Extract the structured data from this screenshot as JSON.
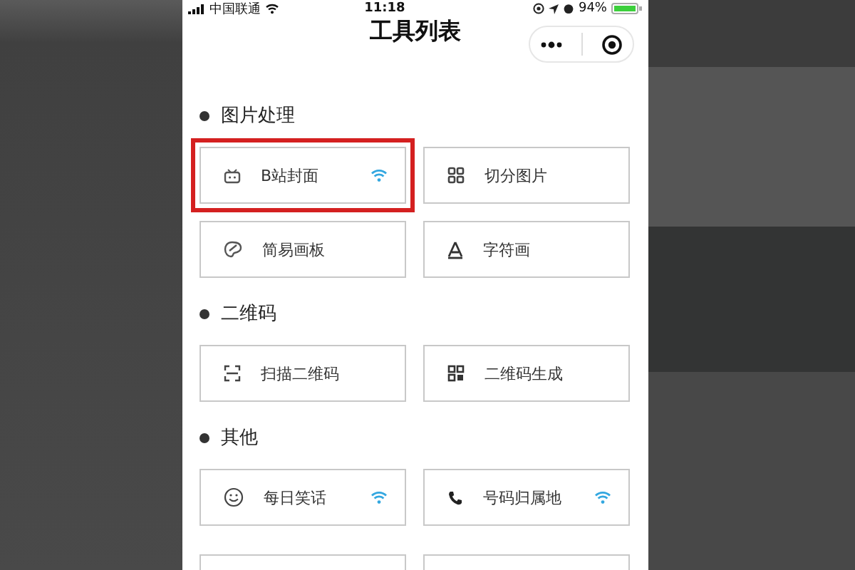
{
  "status_bar": {
    "carrier": "中国联通",
    "time": "11:18",
    "battery": "94%"
  },
  "nav": {
    "title": "工具列表"
  },
  "sections": [
    {
      "title": "图片处理",
      "items": [
        {
          "label": "B站封面",
          "kind": "tv",
          "wifi": true,
          "highlighted": true
        },
        {
          "label": "切分图片",
          "kind": "grid",
          "wifi": false,
          "highlighted": false
        },
        {
          "label": "简易画板",
          "kind": "palette",
          "wifi": false,
          "highlighted": false
        },
        {
          "label": "字符画",
          "kind": "letter",
          "wifi": false,
          "highlighted": false
        }
      ]
    },
    {
      "title": "二维码",
      "items": [
        {
          "label": "扫描二维码",
          "kind": "scan",
          "wifi": false,
          "highlighted": false
        },
        {
          "label": "二维码生成",
          "kind": "qr",
          "wifi": false,
          "highlighted": false
        }
      ]
    },
    {
      "title": "其他",
      "items": [
        {
          "label": "每日笑话",
          "kind": "smile",
          "wifi": true,
          "highlighted": false
        },
        {
          "label": "号码归属地",
          "kind": "phone",
          "wifi": true,
          "highlighted": false
        }
      ]
    }
  ]
}
